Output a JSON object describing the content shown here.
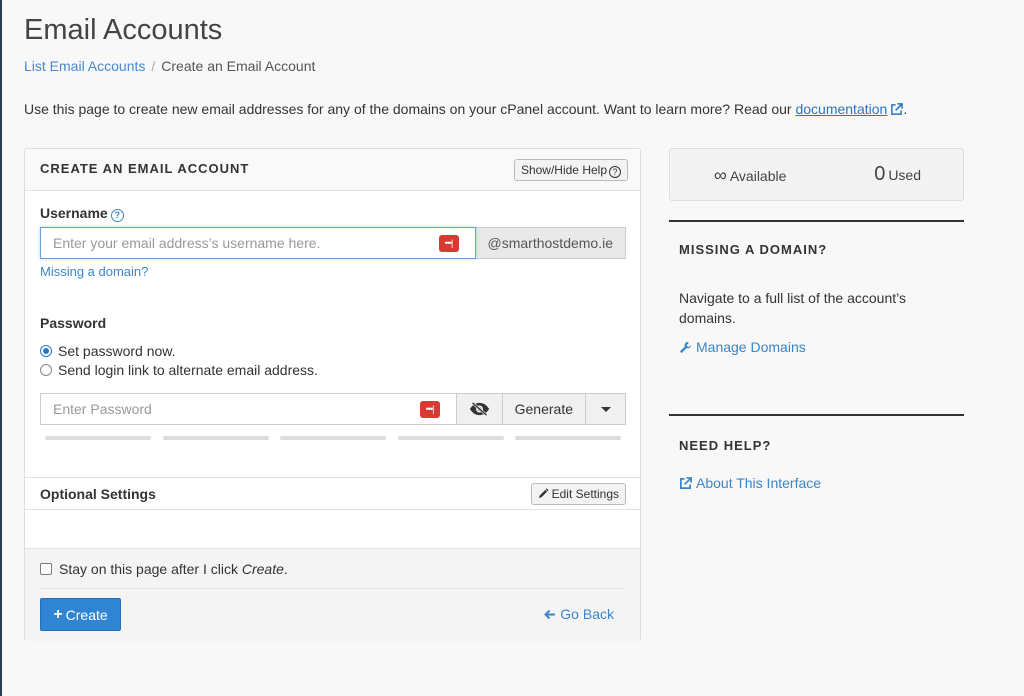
{
  "page": {
    "title": "Email Accounts",
    "breadcrumb": {
      "parent": "List Email Accounts",
      "separator": "/",
      "current": "Create an Email Account"
    },
    "intro_text": "Use this page to create new email addresses for any of the domains on your cPanel account. Want to learn more? Read our",
    "intro_link": "documentation",
    "intro_end": "."
  },
  "form": {
    "heading": "CREATE AN EMAIL ACCOUNT",
    "show_hide_help": "Show/Hide Help",
    "username_label": "Username",
    "username_placeholder": "Enter your email address’s username here.",
    "domain": "@smarthostdemo.ie",
    "missing_domain_link": "Missing a domain?",
    "password_label": "Password",
    "radio_set_now": "Set password now.",
    "radio_send_link": "Send login link to alternate email address.",
    "password_placeholder": "Enter Password",
    "generate_label": "Generate",
    "optional_settings": "Optional Settings",
    "edit_settings": "Edit Settings",
    "stay_text": "Stay on this page after I click",
    "stay_emph": "Create",
    "stay_end": ".",
    "create_label": "Create",
    "go_back": "Go Back",
    "pw_badge": "•••|"
  },
  "stats": {
    "available_symbol": "∞",
    "available_label": "Available",
    "used_count": "0",
    "used_label": "Used"
  },
  "sidebar": {
    "missing_heading": "MISSING A DOMAIN?",
    "missing_text": "Navigate to a full list of the account’s domains.",
    "manage_domains": "Manage Domains",
    "help_heading": "NEED HELP?",
    "about_interface": "About This Interface"
  },
  "colors": {
    "accent": "#2f85d3",
    "link": "#3a86c8",
    "badge": "#d83a33"
  }
}
